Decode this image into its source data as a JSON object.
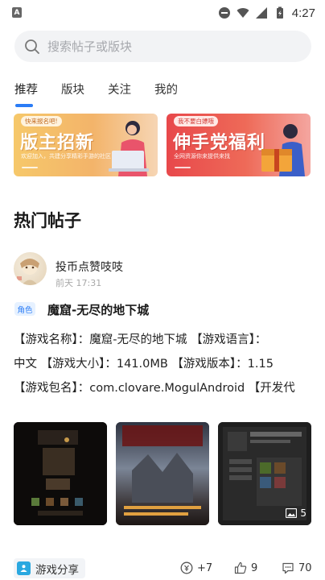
{
  "status_bar": {
    "time": "4:27",
    "left_icon": "A"
  },
  "search": {
    "placeholder": "搜索帖子或版块"
  },
  "tabs": [
    {
      "label": "推荐",
      "active": true
    },
    {
      "label": "版块",
      "active": false
    },
    {
      "label": "关注",
      "active": false
    },
    {
      "label": "我的",
      "active": false
    }
  ],
  "banners": [
    {
      "tag": "快来报名吧!",
      "title": "版主招新",
      "subtitle": "欢迎加入，共建分享精彩手游的社区"
    },
    {
      "tag": "我不要白嫖哦",
      "title": "伸手党福利",
      "subtitle": "全网资源你来提供来找"
    }
  ],
  "section": {
    "title": "热门帖子"
  },
  "post": {
    "author": "投币点赞吱吱",
    "time": "前天 17:31",
    "badge": "角色",
    "title": "魔窟-无尽的地下城",
    "body_lines": [
      "【游戏名称】：魔窟-无尽的地下城 【游戏语言】：",
      "中文 【游戏大小】：141.0MB 【游戏版本】：1.15",
      "【游戏包名】：com.clovare.MogulAndroid 【开发代"
    ],
    "image_count": "5",
    "tag": "游戏分享",
    "coins": "+7",
    "likes": "9",
    "comments": "70"
  },
  "colors": {
    "accent": "#2a7cf6",
    "search_bg": "#f2f3f5"
  }
}
